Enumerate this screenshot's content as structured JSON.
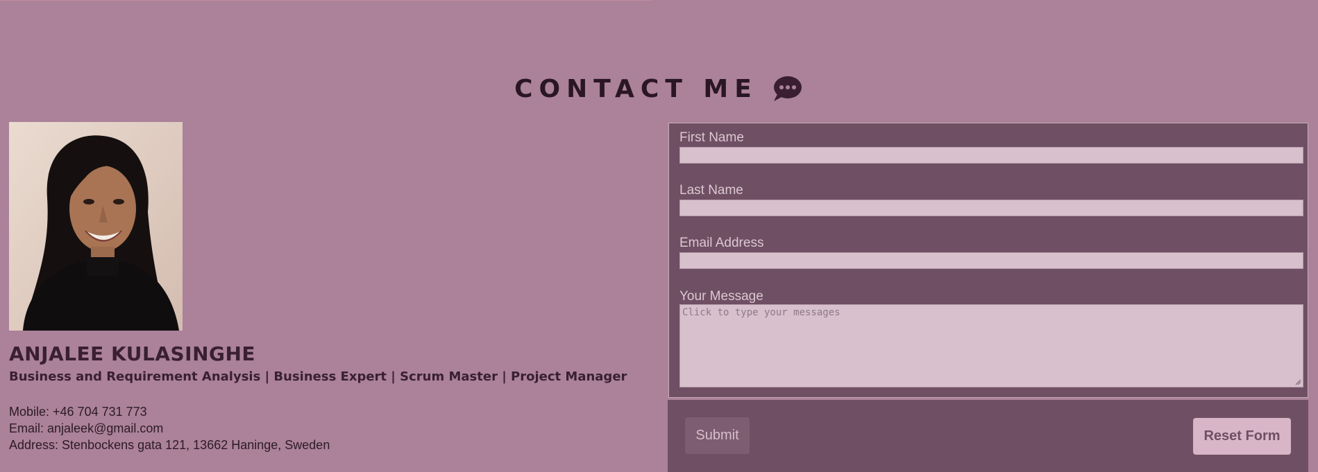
{
  "section": {
    "title": "CONTACT ME",
    "icon": "chat-bubble-icon"
  },
  "profile": {
    "name": "ANJALEE KULASINGHE",
    "roles": "Business and Requirement Analysis | Business Expert | Scrum Master | Project Manager",
    "mobile": "Mobile: +46 704 731 773",
    "email": "Email: anjaleek@gmail.com",
    "address": "Address: Stenbockens gata 121, 13662 Haninge, Sweden",
    "photo_alt": "portrait-photo"
  },
  "form": {
    "first_name_label": "First Name",
    "first_name_value": "",
    "last_name_label": "Last Name",
    "last_name_value": "",
    "email_label": "Email Address",
    "email_value": "",
    "message_label": "Your Message",
    "message_placeholder": "Click to type your messages",
    "submit_label": "Submit",
    "reset_label": "Reset Form"
  },
  "colors": {
    "page_background": "#ab8299",
    "panel_background": "#6f4f63",
    "input_background": "#d8c0cd",
    "heading_text": "#2a1625",
    "reset_button": "#d8b6c8"
  }
}
